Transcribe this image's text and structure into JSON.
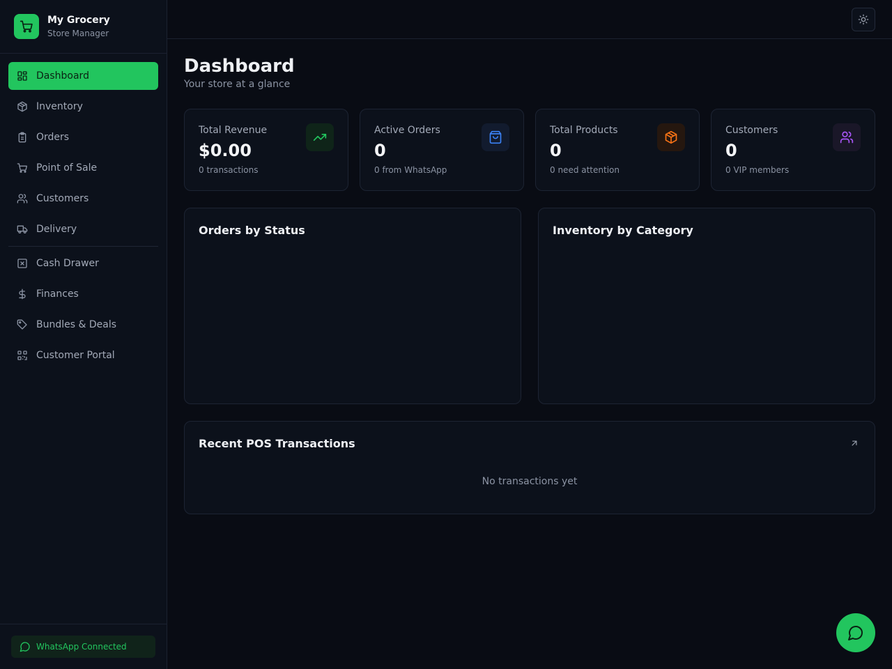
{
  "brand": {
    "name": "My Grocery",
    "subtitle": "Store Manager",
    "icon": "shopping-cart-icon"
  },
  "sidebar": {
    "items": [
      {
        "label": "Dashboard",
        "icon": "layout-grid-icon",
        "active": true
      },
      {
        "label": "Inventory",
        "icon": "package-icon"
      },
      {
        "label": "Orders",
        "icon": "clipboard-icon"
      },
      {
        "label": "Point of Sale",
        "icon": "shopping-cart-icon"
      },
      {
        "label": "Customers",
        "icon": "users-icon"
      },
      {
        "label": "Delivery",
        "icon": "truck-icon"
      },
      {
        "label": "Cash Drawer",
        "icon": "cash-box-icon"
      },
      {
        "label": "Finances",
        "icon": "dollar-icon"
      },
      {
        "label": "Bundles & Deals",
        "icon": "tag-icon"
      },
      {
        "label": "Customer Portal",
        "icon": "qr-code-icon"
      }
    ],
    "footer_status": "WhatsApp Connected"
  },
  "header": {
    "theme_toggle_icon": "sun-icon"
  },
  "page": {
    "title": "Dashboard",
    "subtitle": "Your store at a glance"
  },
  "stats": [
    {
      "label": "Total Revenue",
      "value": "$0.00",
      "sub": "0 transactions",
      "icon": "trending-up-icon",
      "color": "#22c55e"
    },
    {
      "label": "Active Orders",
      "value": "0",
      "sub": "0 from WhatsApp",
      "icon": "shopping-bag-icon",
      "color": "#3b82f6"
    },
    {
      "label": "Total Products",
      "value": "0",
      "sub": "0 need attention",
      "icon": "package-icon",
      "color": "#f97316"
    },
    {
      "label": "Customers",
      "value": "0",
      "sub": "0 VIP members",
      "icon": "users-icon",
      "color": "#a855f7"
    }
  ],
  "panels": {
    "orders_by_status": {
      "title": "Orders by Status"
    },
    "inventory_by_category": {
      "title": "Inventory by Category"
    },
    "recent_transactions": {
      "title": "Recent POS Transactions",
      "empty": "No transactions yet",
      "link_icon": "arrow-up-right-icon"
    }
  },
  "fab": {
    "icon": "chat-bubble-icon"
  },
  "colors": {
    "accent": "#22c55e",
    "background": "#090c14",
    "surface": "#0c111b"
  }
}
